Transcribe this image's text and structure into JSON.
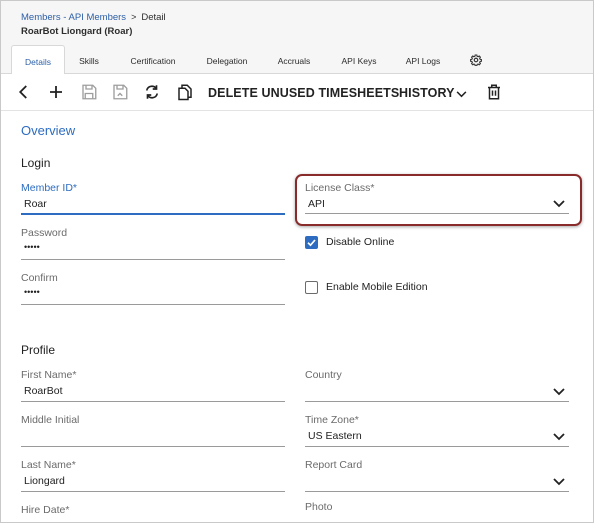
{
  "breadcrumb": {
    "parent": "Members - API Members",
    "separator": ">",
    "current": "Detail"
  },
  "record_title": "RoarBot Liongard (Roar)",
  "tabs": [
    {
      "label": "Details",
      "active": true
    },
    {
      "label": "Skills"
    },
    {
      "label": "Certification"
    },
    {
      "label": "Delegation"
    },
    {
      "label": "Accruals"
    },
    {
      "label": "API Keys"
    },
    {
      "label": "API Logs"
    }
  ],
  "tab_settings_icon": "gear-icon",
  "toolbar": {
    "icons": [
      "back-icon",
      "add-icon",
      "save-icon",
      "save-and-close-icon",
      "refresh-icon",
      "copy-icon",
      "delete-icon"
    ],
    "delete_unused": "DELETE UNUSED TIMESHEETS",
    "history": "HISTORY"
  },
  "overview_title": "Overview",
  "login": {
    "title": "Login",
    "member_id": {
      "label": "Member ID*",
      "value": "Roar"
    },
    "password": {
      "label": "Password",
      "value": "•••••"
    },
    "confirm": {
      "label": "Confirm",
      "value": "•••••"
    },
    "license_class": {
      "label": "License Class*",
      "value": "API"
    },
    "disable_online": {
      "label": "Disable Online",
      "checked": true
    },
    "enable_mobile": {
      "label": "Enable Mobile Edition",
      "checked": false
    }
  },
  "profile": {
    "title": "Profile",
    "first_name": {
      "label": "First Name*",
      "value": "RoarBot"
    },
    "middle_initial": {
      "label": "Middle Initial",
      "value": ""
    },
    "last_name": {
      "label": "Last Name*",
      "value": "Liongard"
    },
    "hire_date": {
      "label": "Hire Date*"
    },
    "country": {
      "label": "Country",
      "value": ""
    },
    "time_zone": {
      "label": "Time Zone*",
      "value": "US Eastern"
    },
    "report_card": {
      "label": "Report Card",
      "value": ""
    },
    "photo": {
      "label": "Photo"
    }
  },
  "colors": {
    "accent": "#2d6cc0",
    "highlight": "#8a2b2b",
    "header_bg": "#f6f6f6"
  }
}
